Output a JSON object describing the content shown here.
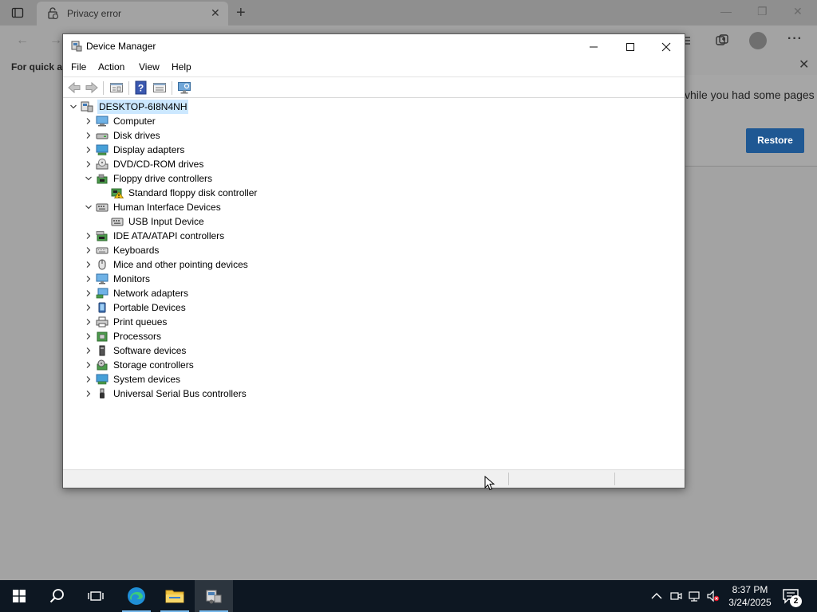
{
  "browser": {
    "tab_title": "Privacy error",
    "quick_access_text": "For quick ac",
    "restore_panel_text": "vhile you had some pages",
    "restore_button": "Restore"
  },
  "device_manager": {
    "title": "Device Manager",
    "menu": [
      "File",
      "Action",
      "View",
      "Help"
    ],
    "root": "DESKTOP-6I8N4NH",
    "tree": [
      {
        "label": "Computer",
        "expanded": false,
        "icon": "computer-icon"
      },
      {
        "label": "Disk drives",
        "expanded": false,
        "icon": "disk-drive-icon"
      },
      {
        "label": "Display adapters",
        "expanded": false,
        "icon": "display-adapter-icon"
      },
      {
        "label": "DVD/CD-ROM drives",
        "expanded": false,
        "icon": "dvd-drive-icon"
      },
      {
        "label": "Floppy drive controllers",
        "expanded": true,
        "icon": "floppy-controller-icon"
      },
      {
        "label": "Standard floppy disk controller",
        "child": true,
        "icon": "warning-device-icon"
      },
      {
        "label": "Human Interface Devices",
        "expanded": true,
        "icon": "hid-icon"
      },
      {
        "label": "USB Input Device",
        "child": true,
        "icon": "hid-device-icon"
      },
      {
        "label": "IDE ATA/ATAPI controllers",
        "expanded": false,
        "icon": "ide-controller-icon"
      },
      {
        "label": "Keyboards",
        "expanded": false,
        "icon": "keyboard-icon"
      },
      {
        "label": "Mice and other pointing devices",
        "expanded": false,
        "icon": "mouse-icon"
      },
      {
        "label": "Monitors",
        "expanded": false,
        "icon": "monitor-icon"
      },
      {
        "label": "Network adapters",
        "expanded": false,
        "icon": "network-adapter-icon"
      },
      {
        "label": "Portable Devices",
        "expanded": false,
        "icon": "portable-device-icon"
      },
      {
        "label": "Print queues",
        "expanded": false,
        "icon": "printer-icon"
      },
      {
        "label": "Processors",
        "expanded": false,
        "icon": "processor-icon"
      },
      {
        "label": "Software devices",
        "expanded": false,
        "icon": "software-device-icon"
      },
      {
        "label": "Storage controllers",
        "expanded": false,
        "icon": "storage-controller-icon"
      },
      {
        "label": "System devices",
        "expanded": false,
        "icon": "system-device-icon"
      },
      {
        "label": "Universal Serial Bus controllers",
        "expanded": false,
        "icon": "usb-icon"
      }
    ]
  },
  "taskbar": {
    "time": "8:37 PM",
    "date": "3/24/2025",
    "notification_count": "2"
  }
}
